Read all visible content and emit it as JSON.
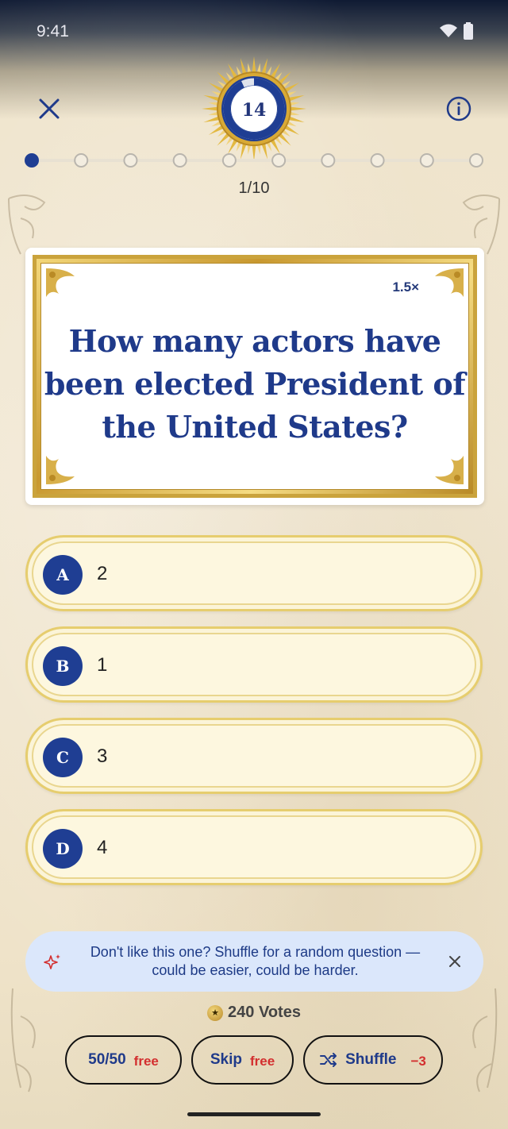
{
  "status_bar": {
    "time": "9:41",
    "wifi_icon": "wifi-icon",
    "battery_icon": "battery-icon"
  },
  "header": {
    "close_icon": "close-icon",
    "info_icon": "info-icon",
    "timer": {
      "value": "14",
      "fraction_remaining": 0.93
    }
  },
  "progress": {
    "current": 1,
    "total": 10,
    "label": "1/10"
  },
  "question": {
    "multiplier": "1.5×",
    "text": "How many actors have been elected President of the United States?"
  },
  "answers": [
    {
      "letter": "A",
      "text": "2"
    },
    {
      "letter": "B",
      "text": "1"
    },
    {
      "letter": "C",
      "text": "3"
    },
    {
      "letter": "D",
      "text": "4"
    }
  ],
  "tip": {
    "icon": "sparkle-icon",
    "text": "Don't like this one? Shuffle for a random question — could be easier, could be harder.",
    "close_icon": "close-icon"
  },
  "votes": {
    "label": "240 Votes",
    "icon": "coin-star-icon"
  },
  "actions": [
    {
      "label": "50/50",
      "cost": "free"
    },
    {
      "label": "Skip",
      "cost": "free"
    },
    {
      "label": "Shuffle",
      "cost": "−3",
      "icon": "shuffle-icon"
    }
  ],
  "colors": {
    "accent_blue": "#1f3e93",
    "gold": "#caa33c",
    "cost_red": "#d32f2f",
    "tip_bg": "#dbe7fb"
  }
}
